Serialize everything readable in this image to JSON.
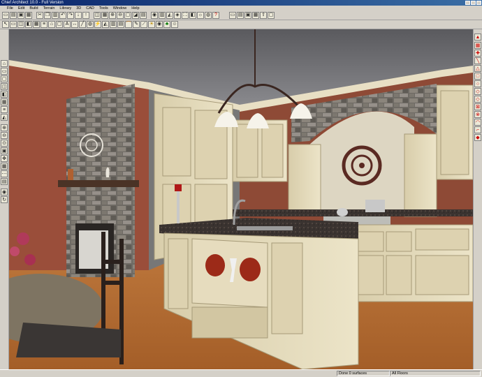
{
  "window": {
    "title": "Chief Architect 10.0 - Full Version"
  },
  "menu": [
    "File",
    "Edit",
    "Build",
    "Terrain",
    "Library",
    "3D",
    "CAD",
    "Tools",
    "Window",
    "Help"
  ],
  "toolbar1": [
    "new-icon",
    "open-icon",
    "save-icon",
    "print-icon",
    "cut-icon",
    "copy-icon",
    "paste-icon",
    "undo-icon",
    "redo-icon",
    "select-icon",
    "zoom-icon",
    "fill-window-icon",
    "camera-icon",
    "help-icon"
  ],
  "toolbar2": [
    "pointer-icon",
    "wall-icon",
    "cabinet-icon",
    "door-icon",
    "window-icon",
    "stairs-icon",
    "roof-icon",
    "text-icon",
    "dimension-icon",
    "material-icon",
    "light-icon",
    "render-icon"
  ],
  "statusbar": {
    "selection": "Done  0 surfaces",
    "floors": "All Floors"
  },
  "colors": {
    "title_start": "#0a246a",
    "title_end": "#3a6ea5",
    "chrome": "#d4d0c8",
    "accent_red": "#cc0000"
  }
}
